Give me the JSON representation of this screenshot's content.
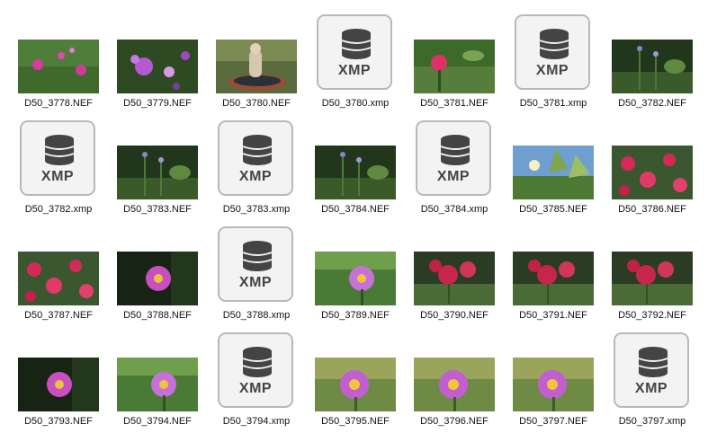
{
  "xmp_badge_label": "XMP",
  "files": [
    {
      "name": "D50_3778.NEF",
      "kind": "photo",
      "scene": "pink-carnations"
    },
    {
      "name": "D50_3779.NEF",
      "kind": "photo",
      "scene": "purple-verbena"
    },
    {
      "name": "D50_3780.NEF",
      "kind": "photo",
      "scene": "fountain-statue"
    },
    {
      "name": "D50_3780.xmp",
      "kind": "xmp",
      "icon": "database-icon"
    },
    {
      "name": "D50_3781.NEF",
      "kind": "photo",
      "scene": "pink-bud"
    },
    {
      "name": "D50_3781.xmp",
      "kind": "xmp",
      "icon": "database-icon"
    },
    {
      "name": "D50_3782.NEF",
      "kind": "photo",
      "scene": "lavender-stems"
    },
    {
      "name": "D50_3782.xmp",
      "kind": "xmp",
      "icon": "database-icon"
    },
    {
      "name": "D50_3783.NEF",
      "kind": "photo",
      "scene": "lavender-stems"
    },
    {
      "name": "D50_3783.xmp",
      "kind": "xmp",
      "icon": "database-icon"
    },
    {
      "name": "D50_3784.NEF",
      "kind": "photo",
      "scene": "lavender-stems"
    },
    {
      "name": "D50_3784.xmp",
      "kind": "xmp",
      "icon": "database-icon"
    },
    {
      "name": "D50_3785.NEF",
      "kind": "photo",
      "scene": "sky-leaves"
    },
    {
      "name": "D50_3786.NEF",
      "kind": "photo",
      "scene": "red-geraniums"
    },
    {
      "name": "D50_3787.NEF",
      "kind": "photo",
      "scene": "red-geraniums"
    },
    {
      "name": "D50_3788.NEF",
      "kind": "photo",
      "scene": "dark-dahlia"
    },
    {
      "name": "D50_3788.xmp",
      "kind": "xmp",
      "icon": "database-icon"
    },
    {
      "name": "D50_3789.NEF",
      "kind": "photo",
      "scene": "pink-daisy"
    },
    {
      "name": "D50_3790.NEF",
      "kind": "photo",
      "scene": "red-flowers"
    },
    {
      "name": "D50_3791.NEF",
      "kind": "photo",
      "scene": "red-flowers"
    },
    {
      "name": "D50_3792.NEF",
      "kind": "photo",
      "scene": "red-flowers"
    },
    {
      "name": "D50_3793.NEF",
      "kind": "photo",
      "scene": "dark-dahlia"
    },
    {
      "name": "D50_3794.NEF",
      "kind": "photo",
      "scene": "pink-daisy"
    },
    {
      "name": "D50_3794.xmp",
      "kind": "xmp",
      "icon": "database-icon"
    },
    {
      "name": "D50_3795.NEF",
      "kind": "photo",
      "scene": "pink-anemone"
    },
    {
      "name": "D50_3796.NEF",
      "kind": "photo",
      "scene": "pink-anemone"
    },
    {
      "name": "D50_3797.NEF",
      "kind": "photo",
      "scene": "pink-anemone"
    },
    {
      "name": "D50_3797.xmp",
      "kind": "xmp",
      "icon": "database-icon"
    }
  ],
  "palette": {
    "xmp_border": "#b9b9b9",
    "xmp_fill": "#f3f3f3",
    "xmp_icon": "#444444"
  }
}
